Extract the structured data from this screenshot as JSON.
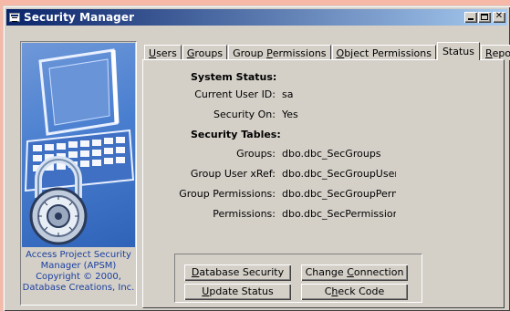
{
  "window": {
    "title": "Security Manager"
  },
  "caption": {
    "line1": "Access Project Security",
    "line2": "Manager (APSM)",
    "line3": "Copyright © 2000,",
    "line4": "Database Creations, Inc."
  },
  "tabs": [
    {
      "label": "Users",
      "mnemonic": "U",
      "rest": "sers",
      "active": false
    },
    {
      "label": "Groups",
      "mnemonic": "G",
      "rest": "roups",
      "active": false
    },
    {
      "label": "Group Permissions",
      "pre": "Group ",
      "mnemonic": "P",
      "rest": "ermissions",
      "active": false
    },
    {
      "label": "Object Permissions",
      "mnemonic": "O",
      "rest": "bject Permissions",
      "active": false
    },
    {
      "label": "Status",
      "active": true
    },
    {
      "label": "Reports",
      "mnemonic": "R",
      "rest": "eports",
      "active": false
    }
  ],
  "status": {
    "system_heading": "System Status:",
    "current_user_label": "Current User ID:",
    "current_user_value": "sa",
    "security_on_label": "Security On:",
    "security_on_value": "Yes",
    "tables_heading": "Security Tables:",
    "groups_label": "Groups:",
    "groups_value": "dbo.dbc_SecGroups",
    "group_user_xref_label": "Group User xRef:",
    "group_user_xref_value": "dbo.dbc_SecGroupUser",
    "group_permissions_label": "Group Permissions:",
    "group_permissions_value": "dbo.dbc_SecGroupPermissior",
    "permissions_label": "Permissions:",
    "permissions_value": "dbo.dbc_SecPermissions"
  },
  "buttons": {
    "database_security": {
      "mnemonic": "D",
      "rest": "atabase Security"
    },
    "change_connection": {
      "pre": "Change ",
      "mnemonic": "C",
      "rest": "onnection"
    },
    "update_status": {
      "mnemonic": "U",
      "rest": "pdate Status"
    },
    "check_code": {
      "pre": "C",
      "mnemonic": "h",
      "rest": "eck Code"
    }
  },
  "colors": {
    "desktop": "#f6b9a8",
    "titlebar_start": "#0a246a",
    "titlebar_end": "#a6caf0",
    "face": "#d4d0c8",
    "caption_text": "#1a3fa0",
    "art_blue": "#4a7fd0"
  }
}
